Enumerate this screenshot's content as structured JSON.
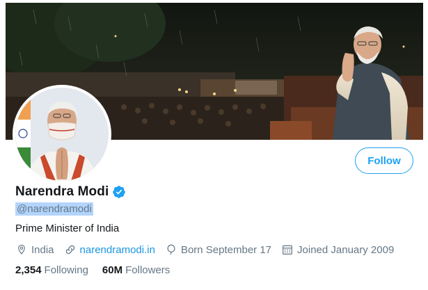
{
  "profile": {
    "display_name": "Narendra Modi",
    "handle": "@narendramodi",
    "bio": "Prime Minister of India",
    "location": "India",
    "website": "narendramodi.in",
    "birthday": "Born September 17",
    "joined": "Joined January 2009",
    "verified": true
  },
  "actions": {
    "follow_label": "Follow"
  },
  "stats": {
    "following_count": "2,354",
    "following_label": "Following",
    "followers_count": "60M",
    "followers_label": "Followers"
  },
  "icons": {
    "location": "location-pin-icon",
    "link": "link-icon",
    "birthday": "balloon-icon",
    "joined": "calendar-icon",
    "verified": "verified-badge-icon"
  },
  "colors": {
    "accent": "#1da1f2",
    "link": "#1b95e0",
    "secondary_text": "#657786",
    "primary_text": "#14171a",
    "handle_highlight": "#b3d4fc"
  }
}
